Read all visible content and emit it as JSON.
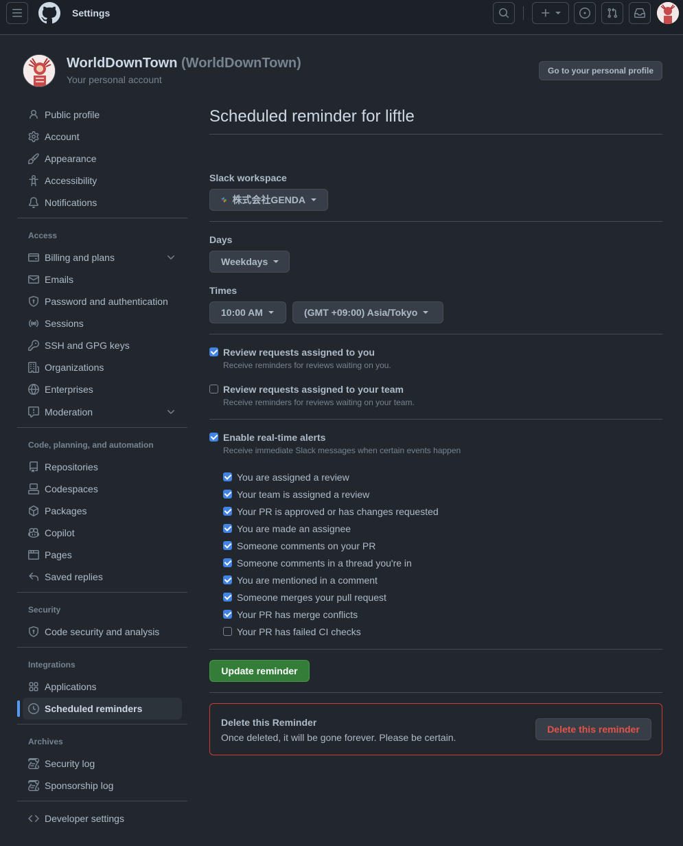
{
  "header": {
    "title": "Settings"
  },
  "account": {
    "name": "WorldDownTown",
    "login": "(WorldDownTown)",
    "subtitle": "Your personal account",
    "profile_button": "Go to your personal profile"
  },
  "sidebar": {
    "items": [
      {
        "label": "Public profile",
        "icon": "person-icon"
      },
      {
        "label": "Account",
        "icon": "gear-icon"
      },
      {
        "label": "Appearance",
        "icon": "paintbrush-icon"
      },
      {
        "label": "Accessibility",
        "icon": "accessibility-icon"
      },
      {
        "label": "Notifications",
        "icon": "bell-icon"
      }
    ],
    "access_heading": "Access",
    "access_items": [
      {
        "label": "Billing and plans",
        "icon": "credit-card-icon"
      },
      {
        "label": "Emails",
        "icon": "mail-icon"
      },
      {
        "label": "Password and authentication",
        "icon": "shield-lock-icon"
      },
      {
        "label": "Sessions",
        "icon": "broadcast-icon"
      },
      {
        "label": "SSH and GPG keys",
        "icon": "key-icon"
      },
      {
        "label": "Organizations",
        "icon": "organization-icon"
      },
      {
        "label": "Enterprises",
        "icon": "globe-icon"
      },
      {
        "label": "Moderation",
        "icon": "report-icon"
      }
    ],
    "code_heading": "Code, planning, and automation",
    "code_items": [
      {
        "label": "Repositories",
        "icon": "repo-icon"
      },
      {
        "label": "Codespaces",
        "icon": "codespaces-icon"
      },
      {
        "label": "Packages",
        "icon": "package-icon"
      },
      {
        "label": "Copilot",
        "icon": "copilot-icon"
      },
      {
        "label": "Pages",
        "icon": "browser-icon"
      },
      {
        "label": "Saved replies",
        "icon": "reply-icon"
      }
    ],
    "security_heading": "Security",
    "security_items": [
      {
        "label": "Code security and analysis",
        "icon": "shield-lock-icon"
      }
    ],
    "integrations_heading": "Integrations",
    "integrations_items": [
      {
        "label": "Applications",
        "icon": "apps-icon"
      },
      {
        "label": "Scheduled reminders",
        "icon": "clock-icon"
      }
    ],
    "archives_heading": "Archives",
    "archives_items": [
      {
        "label": "Security log",
        "icon": "log-icon"
      },
      {
        "label": "Sponsorship log",
        "icon": "log-icon"
      }
    ],
    "developer": {
      "label": "Developer settings",
      "icon": "code-icon"
    }
  },
  "main": {
    "title": "Scheduled reminder for liftle",
    "slack_label": "Slack workspace",
    "slack_value": "株式会社GENDA",
    "days_label": "Days",
    "days_value": "Weekdays",
    "times_label": "Times",
    "time_value": "10:00 AM",
    "timezone_value": "(GMT +09:00) Asia/Tokyo",
    "review_you_title": "Review requests assigned to you",
    "review_you_note": "Receive reminders for reviews waiting on you.",
    "review_you_checked": true,
    "review_team_title": "Review requests assigned to your team",
    "review_team_note": "Receive reminders for reviews waiting on your team.",
    "review_team_checked": false,
    "realtime_title": "Enable real-time alerts",
    "realtime_note": "Receive immediate Slack messages when certain events happen",
    "realtime_checked": true,
    "alerts": [
      {
        "label": "You are assigned a review",
        "checked": true
      },
      {
        "label": "Your team is assigned a review",
        "checked": true
      },
      {
        "label": "Your PR is approved or has changes requested",
        "checked": true
      },
      {
        "label": "You are made an assignee",
        "checked": true
      },
      {
        "label": "Someone comments on your PR",
        "checked": true
      },
      {
        "label": "Someone comments in a thread you're in",
        "checked": true
      },
      {
        "label": "You are mentioned in a comment",
        "checked": true
      },
      {
        "label": "Someone merges your pull request",
        "checked": true
      },
      {
        "label": "Your PR has merge conflicts",
        "checked": true
      },
      {
        "label": "Your PR has failed CI checks",
        "checked": false
      }
    ],
    "update_button": "Update reminder",
    "danger_title": "Delete this Reminder",
    "danger_text": "Once deleted, it will be gone forever. Please be certain.",
    "danger_button": "Delete this reminder"
  },
  "colors": {
    "background": "#22272e",
    "accent": "#539bf5",
    "primary_button": "#347d39",
    "danger": "#e5534b"
  }
}
